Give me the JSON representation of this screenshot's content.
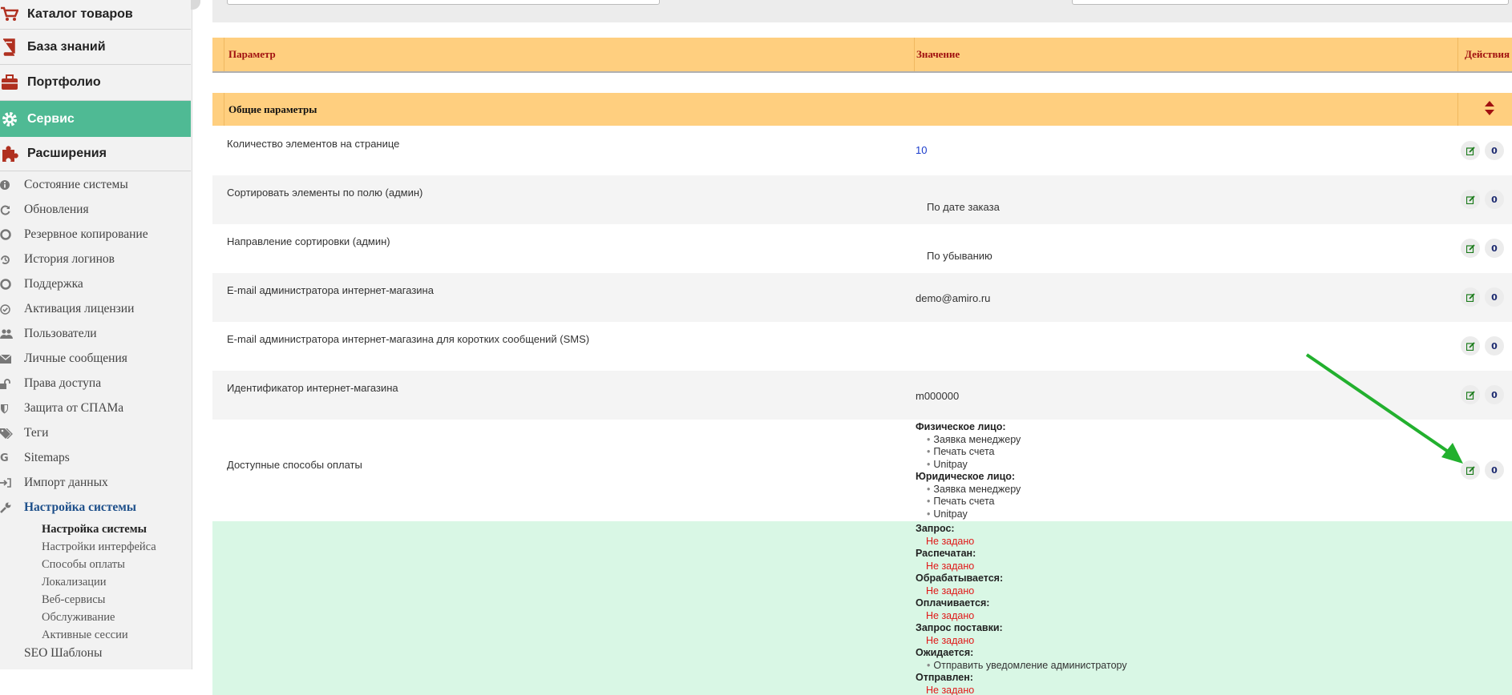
{
  "sidebar": {
    "main_items": [
      {
        "label": "Каталог товаров",
        "icon": "cart-icon"
      },
      {
        "label": "База знаний",
        "icon": "book-icon"
      },
      {
        "label": "Портфолио",
        "icon": "briefcase-icon"
      },
      {
        "label": "Сервис",
        "icon": "gear-icon"
      },
      {
        "label": "Расширения",
        "icon": "puzzle-icon"
      }
    ],
    "sub_items": [
      {
        "label": "Состояние системы",
        "icon": "info-icon"
      },
      {
        "label": "Обновления",
        "icon": "refresh-icon"
      },
      {
        "label": "Резервное копирование",
        "icon": "lifebuoy-icon"
      },
      {
        "label": "История логинов",
        "icon": "history-icon"
      },
      {
        "label": "Поддержка",
        "icon": "lifebuoy-icon"
      },
      {
        "label": "Активация лицензии",
        "icon": "check-circle-icon"
      },
      {
        "label": "Пользователи",
        "icon": "users-icon"
      },
      {
        "label": "Личные сообщения",
        "icon": "envelope-icon"
      },
      {
        "label": "Права доступа",
        "icon": "unlock-icon"
      },
      {
        "label": "Защита от СПАМа",
        "icon": "shield-icon"
      },
      {
        "label": "Теги",
        "icon": "tags-icon"
      },
      {
        "label": "Sitemaps",
        "icon": "google-icon"
      },
      {
        "label": "Импорт данных",
        "icon": "sign-in-icon"
      },
      {
        "label": "Настройка системы",
        "icon": "wrench-icon"
      }
    ],
    "settings_items": [
      "Настройка системы",
      "Настройки интерфейса",
      "Способы оплаты",
      "Локализации",
      "Веб-сервисы",
      "Обслуживание",
      "Активные сессии"
    ],
    "seo_label": "SEO Шаблоны"
  },
  "table": {
    "headers": {
      "param": "Параметр",
      "value": "Значение",
      "actions": "Действия"
    },
    "group_title": "Общие параметры",
    "rows": [
      {
        "param": "Количество элементов на странице",
        "value": "10"
      },
      {
        "param": "Сортировать элементы по полю (админ)",
        "value": "По дате заказа"
      },
      {
        "param": "Направление сортировки (админ)",
        "value": "По убыванию"
      },
      {
        "param": "E-mail администратора интернет-магазина",
        "value": "demo@amiro.ru"
      },
      {
        "param": "E-mail администратора интернет-магазина для коротких сообщений (SMS)",
        "value": ""
      },
      {
        "param": "Идентификатор интернет-магазина",
        "value": "m000000"
      }
    ],
    "payment": {
      "param": "Доступные способы оплаты",
      "individual_label": "Физическое лицо:",
      "individual_items": [
        "Заявка менеджеру",
        "Печать счета",
        "Unitpay"
      ],
      "legal_label": "Юридическое лицо:",
      "legal_items": [
        "Заявка менеджеру",
        "Печать счета",
        "Unitpay"
      ]
    },
    "statuses": {
      "request": "Запрос:",
      "printed": "Распечатан:",
      "processing": "Обрабатывается:",
      "paying": "Оплачивается:",
      "supply_request": "Запрос поставки:",
      "expected": "Ожидается:",
      "sent": "Отправлен:",
      "not_set": "Не задано",
      "notify_admin": "Отправить уведомление администратору"
    },
    "action_icons": {
      "edit": "edit-icon",
      "zero_glyph": "0"
    }
  },
  "colors": {
    "active_menu": "#4fba94",
    "table_header": "#ffcf7f",
    "header_text": "#a01010",
    "highlight_row": "#d9f7e5",
    "arrow": "#22b02e"
  }
}
